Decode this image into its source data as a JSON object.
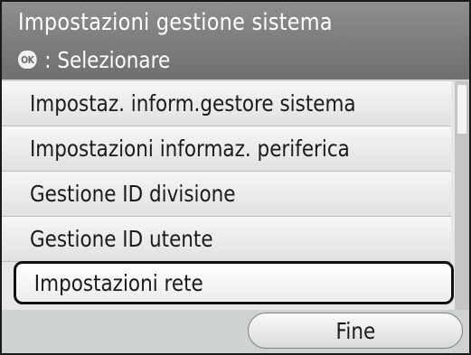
{
  "header": {
    "title": "Impostazioni gestione sistema",
    "ok_icon_label": "OK",
    "instruction": ": Selezionare"
  },
  "menu": {
    "items": [
      {
        "label": "Impostaz. inform.gestore sistema"
      },
      {
        "label": "Impostazioni informaz. periferica"
      },
      {
        "label": "Gestione ID divisione"
      },
      {
        "label": "Gestione ID utente"
      },
      {
        "label": "Impostazioni rete"
      }
    ],
    "selected_index": 4
  },
  "footer": {
    "fine_label": "Fine"
  }
}
